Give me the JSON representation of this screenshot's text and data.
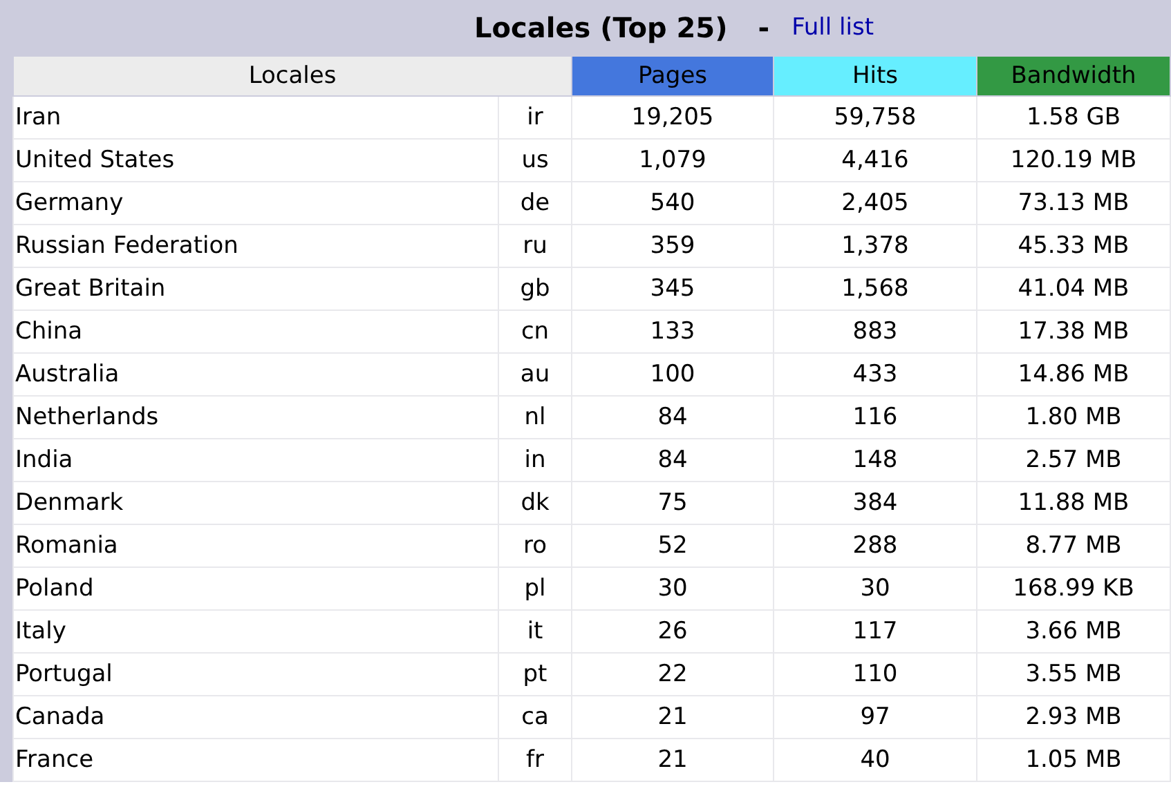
{
  "title": "Locales (Top 25)",
  "separator": "-",
  "full_list_link": "Full list",
  "columns": [
    {
      "label": "Locales",
      "color": "#ececec"
    },
    {
      "label": "Pages",
      "color": "#4477dd"
    },
    {
      "label": "Hits",
      "color": "#66eeff"
    },
    {
      "label": "Bandwidth",
      "color": "#339944"
    }
  ],
  "rows": [
    {
      "name": "Iran",
      "code": "ir",
      "pages": "19,205",
      "hits": "59,758",
      "bandwidth": "1.58 GB"
    },
    {
      "name": "United States",
      "code": "us",
      "pages": "1,079",
      "hits": "4,416",
      "bandwidth": "120.19 MB"
    },
    {
      "name": "Germany",
      "code": "de",
      "pages": "540",
      "hits": "2,405",
      "bandwidth": "73.13 MB"
    },
    {
      "name": "Russian Federation",
      "code": "ru",
      "pages": "359",
      "hits": "1,378",
      "bandwidth": "45.33 MB"
    },
    {
      "name": "Great Britain",
      "code": "gb",
      "pages": "345",
      "hits": "1,568",
      "bandwidth": "41.04 MB"
    },
    {
      "name": "China",
      "code": "cn",
      "pages": "133",
      "hits": "883",
      "bandwidth": "17.38 MB"
    },
    {
      "name": "Australia",
      "code": "au",
      "pages": "100",
      "hits": "433",
      "bandwidth": "14.86 MB"
    },
    {
      "name": "Netherlands",
      "code": "nl",
      "pages": "84",
      "hits": "116",
      "bandwidth": "1.80 MB"
    },
    {
      "name": "India",
      "code": "in",
      "pages": "84",
      "hits": "148",
      "bandwidth": "2.57 MB"
    },
    {
      "name": "Denmark",
      "code": "dk",
      "pages": "75",
      "hits": "384",
      "bandwidth": "11.88 MB"
    },
    {
      "name": "Romania",
      "code": "ro",
      "pages": "52",
      "hits": "288",
      "bandwidth": "8.77 MB"
    },
    {
      "name": "Poland",
      "code": "pl",
      "pages": "30",
      "hits": "30",
      "bandwidth": "168.99 KB"
    },
    {
      "name": "Italy",
      "code": "it",
      "pages": "26",
      "hits": "117",
      "bandwidth": "3.66 MB"
    },
    {
      "name": "Portugal",
      "code": "pt",
      "pages": "22",
      "hits": "110",
      "bandwidth": "3.55 MB"
    },
    {
      "name": "Canada",
      "code": "ca",
      "pages": "21",
      "hits": "97",
      "bandwidth": "2.93 MB"
    },
    {
      "name": "France",
      "code": "fr",
      "pages": "21",
      "hits": "40",
      "bandwidth": "1.05 MB"
    }
  ]
}
